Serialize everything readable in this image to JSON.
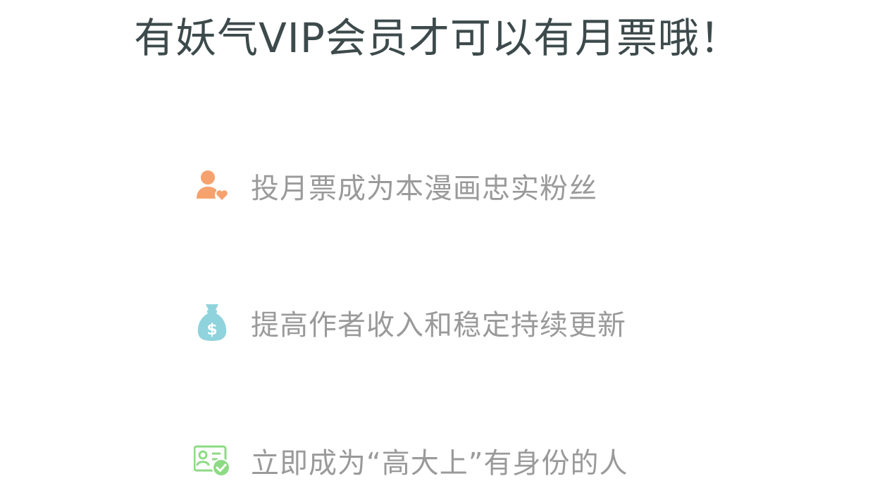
{
  "title": "有妖气VIP会员才可以有月票哦！",
  "benefits": [
    {
      "icon": "fan-heart-icon",
      "color": "#f5a26e",
      "label": "投月票成为本漫画忠实粉丝"
    },
    {
      "icon": "money-bag-icon",
      "color": "#8fd3dc",
      "label": "提高作者收入和稳定持续更新"
    },
    {
      "icon": "verified-id-card-icon",
      "color": "#8ddb84",
      "label": "立即成为“高大上”有身份的人"
    }
  ]
}
